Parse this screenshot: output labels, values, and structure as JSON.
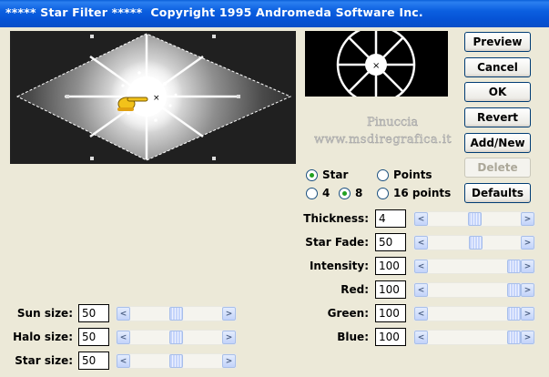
{
  "window": {
    "title": "***** Star Filter *****  Copyright 1995 Andromeda Software Inc."
  },
  "buttons": {
    "preview": "Preview",
    "cancel": "Cancel",
    "ok": "OK",
    "revert": "Revert",
    "add_new": "Add/New",
    "delete": "Delete",
    "defaults": "Defaults"
  },
  "watermark": {
    "line1": "Pinuccia",
    "line2": "www.msdiregrafica.it"
  },
  "mode": {
    "star_label": "Star",
    "star_selected": true,
    "points_label": "Points",
    "points_selected": false
  },
  "points_count": {
    "opt4_label": "4",
    "opt4_selected": false,
    "opt8_label": "8",
    "opt8_selected": true,
    "opt16_label": "16 points",
    "opt16_selected": false
  },
  "controls": {
    "thickness": {
      "label": "Thickness:",
      "value": "4",
      "level": 0.5
    },
    "star_fade": {
      "label": "Star Fade:",
      "value": "50",
      "level": 0.52
    },
    "intensity": {
      "label": "Intensity:",
      "value": "100",
      "level": 1.0
    },
    "red": {
      "label": "Red:",
      "value": "100",
      "level": 1.0
    },
    "green": {
      "label": "Green:",
      "value": "100",
      "level": 1.0
    },
    "blue": {
      "label": "Blue:",
      "value": "100",
      "level": 1.0
    },
    "sun_size": {
      "label": "Sun size:",
      "value": "50",
      "level": 0.5
    },
    "halo_size": {
      "label": "Halo size:",
      "value": "50",
      "level": 0.5
    },
    "star_size": {
      "label": "Star size:",
      "value": "50",
      "level": 0.5
    }
  },
  "colors": {
    "title_bar": "#0a5fd8",
    "radio_fill": "#21a121",
    "scroll_arrow": "#c3d3fa"
  }
}
